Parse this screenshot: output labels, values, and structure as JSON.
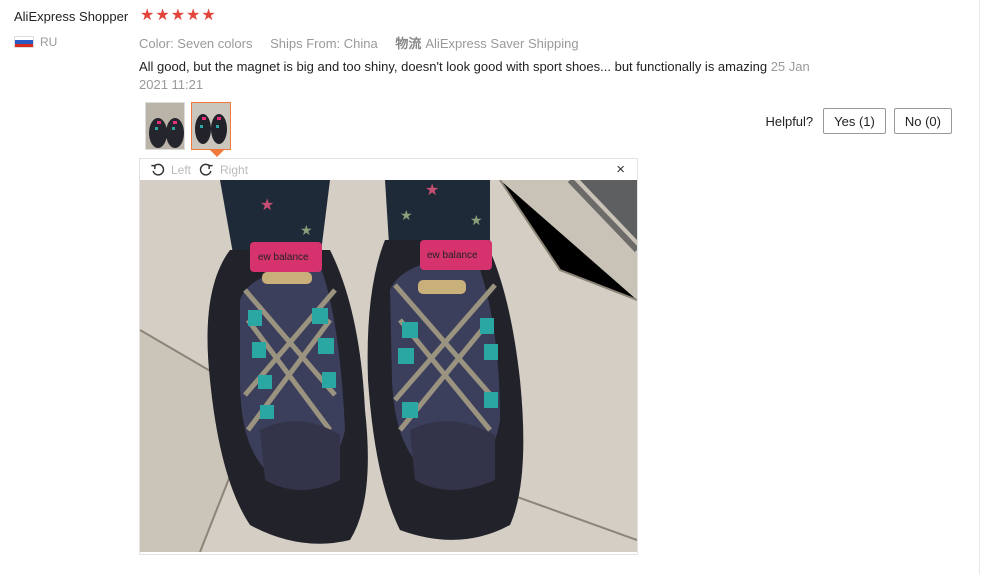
{
  "reviewer": {
    "name": "AliExpress Shopper",
    "country": "RU",
    "flag_colors": [
      "#ffffff",
      "#2b59c3",
      "#d52b1e"
    ]
  },
  "rating": {
    "stars": 5,
    "star_color": "#e2453c"
  },
  "meta": {
    "color": "Color: Seven colors",
    "ships_from": "Ships From: China",
    "shipping_icon": "物流",
    "shipping": "AliExpress Saver Shipping"
  },
  "review": {
    "text": "All good, but the magnet is big and too shiny, doesn't look good with sport shoes... but functionally is amazing",
    "date": "25 Jan 2021 11:21"
  },
  "helpful": {
    "label": "Helpful?",
    "yes": "Yes (1)",
    "no": "No (0)"
  },
  "viewer": {
    "rotate_left": "Left",
    "rotate_right": "Right",
    "close": "×",
    "selected_thumb": 2,
    "accent": "#f0793b"
  }
}
